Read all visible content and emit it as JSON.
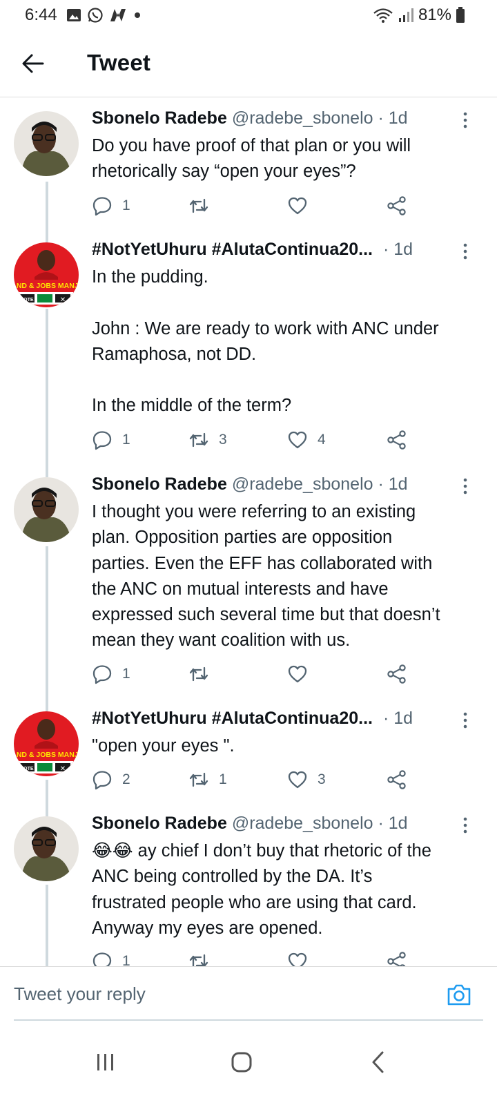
{
  "status": {
    "time": "6:44",
    "battery": "81%"
  },
  "header": {
    "title": "Tweet"
  },
  "tweets": [
    {
      "name": "Sbonelo Radebe",
      "handle": "@radebe_sbonelo",
      "time": "· 1d",
      "text": "Do you have proof of that plan or you will\nrhetorically say “open your eyes”?",
      "replies": "1",
      "retweets": "",
      "likes": ""
    },
    {
      "name": "#NotYetUhuru #AlutaContinua20...",
      "handle": "",
      "time": "· 1d",
      "text": "In the pudding.\n\nJohn : We are ready to work with ANC under\nRamaphosa, not DD.\n\nIn the middle of the term?",
      "replies": "1",
      "retweets": "3",
      "likes": "4"
    },
    {
      "name": "Sbonelo Radebe",
      "handle": "@radebe_sbonelo",
      "time": "· 1d",
      "text": "I thought you were referring to an existing\nplan. Opposition parties are opposition\nparties. Even the EFF has collaborated with\nthe ANC on mutual interests and have\nexpressed such several time but that doesn’t\nmean they want coalition with us.",
      "replies": "1",
      "retweets": "",
      "likes": ""
    },
    {
      "name": "#NotYetUhuru #AlutaContinua20...",
      "handle": "",
      "time": "· 1d",
      "text": "\"open your eyes \".",
      "replies": "2",
      "retweets": "1",
      "likes": "3"
    },
    {
      "name": "Sbonelo Radebe",
      "handle": "@radebe_sbonelo",
      "time": "· 1d",
      "text": "😂😂 ay chief I don’t buy that rhetoric of the\nANC being controlled by the DA. It’s\nfrustrated people who are using that card.\nAnyway my eyes are opened.",
      "replies": "1",
      "retweets": "",
      "likes": ""
    }
  ],
  "avatar_banner": {
    "line1": "LAND & JOBS MANJE!",
    "vote": "VOTE",
    "x": "✕"
  },
  "reply": {
    "placeholder": "Tweet your reply"
  },
  "colors": {
    "accent": "#1d9bf0",
    "muted": "#536471",
    "efff_red": "#e11b22"
  }
}
